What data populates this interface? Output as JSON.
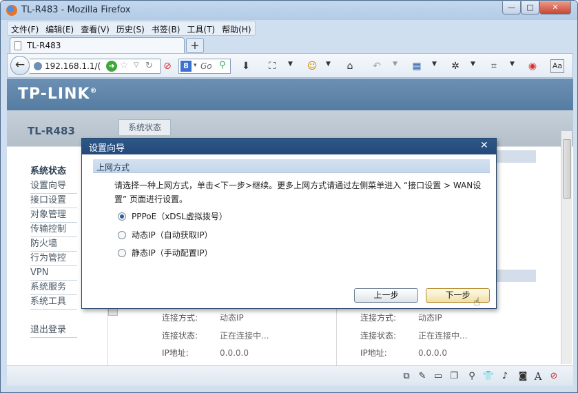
{
  "window": {
    "title": "TL-R483 - Mozilla Firefox",
    "minimize_glyph": "—",
    "maximize_glyph": "□",
    "close_glyph": "✕"
  },
  "menubar": {
    "items": [
      "文件(F)",
      "编辑(E)",
      "查看(V)",
      "历史(S)",
      "书签(B)",
      "工具(T)",
      "帮助(H)"
    ]
  },
  "tabs": {
    "active_label": "TL-R483",
    "new_tab_glyph": "+"
  },
  "navbar": {
    "back_glyph": "←",
    "url": "192.168.1.1/(",
    "search_engine_letter": "8",
    "search_placeholder": "Go"
  },
  "page": {
    "brand": "TP-LINK",
    "brand_mark": "®",
    "model": "TL-R483",
    "active_tab": "系统状态",
    "sidebar": {
      "items": [
        "系统状态",
        "设置向导",
        "接口设置",
        "对象管理",
        "传输控制",
        "防火墙",
        "行为管控",
        "VPN",
        "系统服务",
        "系统工具"
      ],
      "logout": "退出登录"
    },
    "left_panel": {
      "rows": [
        {
          "key": "连接方式:",
          "value": "动态IP"
        },
        {
          "key": "连接状态:",
          "value": "正在连接中..."
        },
        {
          "key": "IP地址:",
          "value": "0.0.0.0"
        }
      ]
    },
    "right_panel": {
      "rows": [
        {
          "key": "连接方式:",
          "value": "动态IP"
        },
        {
          "key": "连接状态:",
          "value": "正在连接中..."
        },
        {
          "key": "IP地址:",
          "value": "0.0.0.0"
        }
      ]
    }
  },
  "wizard": {
    "title": "设置向导",
    "close_glyph": "✕",
    "section_title": "上网方式",
    "description": "请选择一种上网方式，单击<下一步>继续。更多上网方式请通过左侧菜单进入 “接口设置 > WAN设置” 页面进行设置。",
    "options": [
      {
        "label": "PPPoE（xDSL虚拟拨号）",
        "selected": true
      },
      {
        "label": "动态IP（自动获取IP）",
        "selected": false
      },
      {
        "label": "静态IP（手动配置IP）",
        "selected": false
      }
    ],
    "prev_button": "上一步",
    "next_button": "下一步"
  },
  "colors": {
    "brand_bar": "#557ca2",
    "modal_header": "#24497a",
    "next_button_border": "#b78c2b"
  }
}
